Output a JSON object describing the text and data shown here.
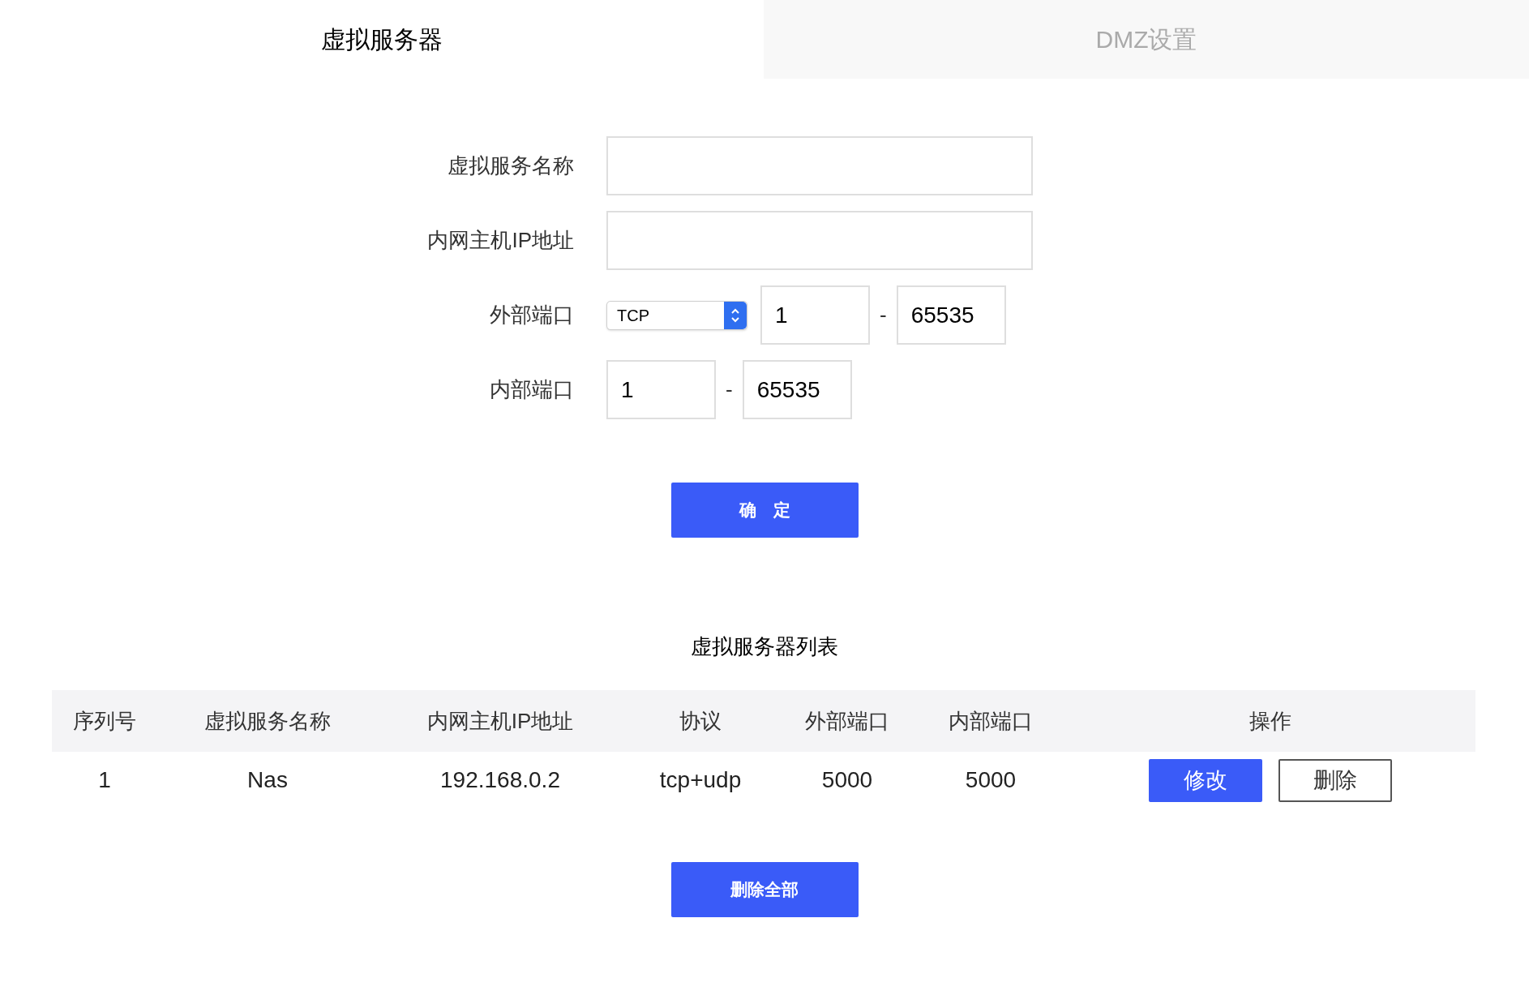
{
  "tabs": [
    {
      "label": "虚拟服务器",
      "selected": true
    },
    {
      "label": "DMZ设置",
      "selected": false
    }
  ],
  "form": {
    "fields": [
      {
        "kind": "text",
        "label": "虚拟服务名称"
      },
      {
        "kind": "text",
        "label": "内网主机IP地址"
      },
      {
        "kind": "protocol_range",
        "label": "外部端口",
        "protocol": "TCP",
        "from": "1",
        "separator": "-",
        "to": "65535"
      },
      {
        "kind": "range",
        "label": "内部端口",
        "from": "1",
        "separator": "-",
        "to": "65535"
      }
    ],
    "submit": "确　定"
  },
  "list": {
    "title": "虚拟服务器列表",
    "columns": [
      "序列号",
      "虚拟服务名称",
      "内网主机IP地址",
      "协议",
      "外部端口",
      "内部端口",
      "操作"
    ],
    "rows": [
      {
        "cells": [
          "1",
          "Nas",
          "192.168.0.2",
          "tcp+udp",
          "5000",
          "5000"
        ],
        "actions": [
          {
            "kind": "primary",
            "label": "修改"
          },
          {
            "kind": "outline",
            "label": "删除"
          }
        ]
      }
    ],
    "delete_all": "删除全部"
  }
}
